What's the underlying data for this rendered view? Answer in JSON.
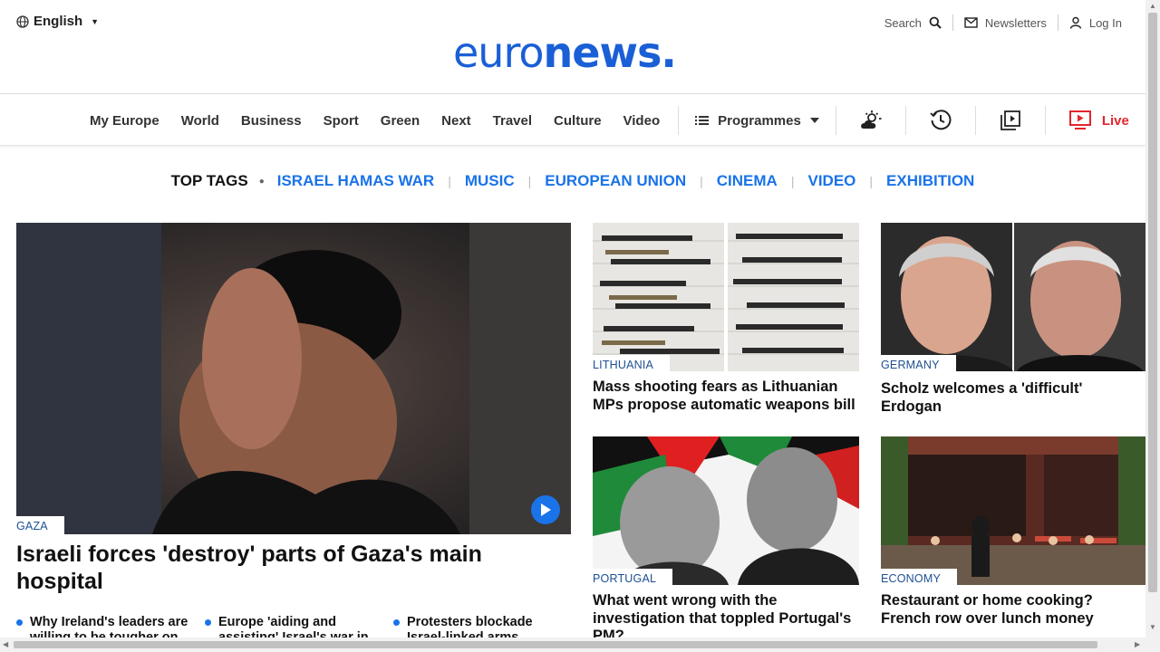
{
  "header": {
    "language": "English",
    "logo_light": "euro",
    "logo_bold": "news",
    "logo_dot": ".",
    "search_label": "Search",
    "newsletters_label": "Newsletters",
    "login_label": "Log In"
  },
  "nav": {
    "items": [
      "My Europe",
      "World",
      "Business",
      "Sport",
      "Green",
      "Next",
      "Travel",
      "Culture",
      "Video"
    ],
    "programmes_label": "Programmes",
    "live_label": "Live"
  },
  "tags": {
    "heading": "TOP TAGS",
    "items": [
      "ISRAEL HAMAS WAR",
      "MUSIC",
      "EUROPEAN UNION",
      "CINEMA",
      "VIDEO",
      "EXHIBITION"
    ]
  },
  "hero": {
    "category": "GAZA",
    "title": "Israeli forces 'destroy' parts of Gaza's main hospital",
    "sub_stories": [
      "Why Ireland's leaders are willing to be tougher on",
      "Europe 'aiding and assisting' Israel's war in",
      "Protesters blockade Israel-linked arms"
    ]
  },
  "cards": [
    {
      "category": "LITHUANIA",
      "title": "Mass shooting fears as Lithuanian MPs propose automatic weapons bill"
    },
    {
      "category": "GERMANY",
      "title": "Scholz welcomes a 'difficult' Erdogan"
    },
    {
      "category": "PORTUGAL",
      "title": "What went wrong with the investigation that toppled Portugal's PM?"
    },
    {
      "category": "ECONOMY",
      "title": "Restaurant or home cooking? French row over lunch money"
    }
  ],
  "colors": {
    "brand_blue": "#1a5fd6",
    "link_blue": "#1a73e8",
    "live_red": "#e3262c",
    "category_blue": "#1d4f91"
  }
}
